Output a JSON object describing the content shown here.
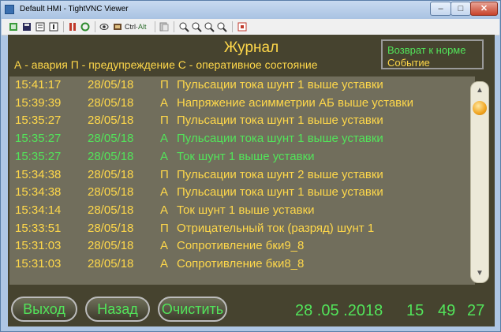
{
  "window": {
    "title": "Default HMI - TightVNC Viewer",
    "minimize": "–",
    "maximize": "□",
    "close": "✕"
  },
  "toolbar": {
    "ctrl_label": "Ctrl",
    "alt_label": "Alt"
  },
  "journal": {
    "title": "Журнал",
    "legend": "А - авария  П - предупреждение С - оперативное состояние",
    "status_normal": "Возврат к норме",
    "status_event": "Событие",
    "rows": [
      {
        "time": "15:41:17",
        "date": "28/05/18",
        "type": "П",
        "message": "Пульсации тока шунт 1 выше уставки",
        "color": "#ffd84a"
      },
      {
        "time": "15:39:39",
        "date": "28/05/18",
        "type": "А",
        "message": "Напряжение асимметрии АБ выше уставки",
        "color": "#ffd84a"
      },
      {
        "time": "15:35:27",
        "date": "28/05/18",
        "type": "П",
        "message": "Пульсации тока шунт 1 выше уставки",
        "color": "#ffd84a"
      },
      {
        "time": "15:35:27",
        "date": "28/05/18",
        "type": "А",
        "message": "Пульсации тока шунт 1 выше уставки",
        "color": "#52e45a"
      },
      {
        "time": "15:35:27",
        "date": "28/05/18",
        "type": "А",
        "message": "Ток шунт 1 выше уставки",
        "color": "#52e45a"
      },
      {
        "time": "15:34:38",
        "date": "28/05/18",
        "type": "П",
        "message": "Пульсации тока шунт 2 выше уставки",
        "color": "#ffd84a"
      },
      {
        "time": "15:34:38",
        "date": "28/05/18",
        "type": "А",
        "message": "Пульсации тока шунт 1 выше уставки",
        "color": "#ffd84a"
      },
      {
        "time": "15:34:14",
        "date": "28/05/18",
        "type": "А",
        "message": "Ток шунт 1 выше уставки",
        "color": "#ffd84a"
      },
      {
        "time": "15:33:51",
        "date": "28/05/18",
        "type": "П",
        "message": "Отрицательный ток (разряд) шунт 1",
        "color": "#ffd84a"
      },
      {
        "time": "15:31:03",
        "date": "28/05/18",
        "type": "А",
        "message": "Сопротивление  бки9_8",
        "color": "#ffd84a"
      },
      {
        "time": "15:31:03",
        "date": "28/05/18",
        "type": "А",
        "message": "Сопротивление  бки8_8",
        "color": "#ffd84a"
      }
    ]
  },
  "buttons": {
    "exit": "Выход",
    "back": "Назад",
    "clear": "Очистить"
  },
  "clock": {
    "date": "28 .05 .2018",
    "hours": "15",
    "minutes": "49",
    "seconds": "27"
  }
}
